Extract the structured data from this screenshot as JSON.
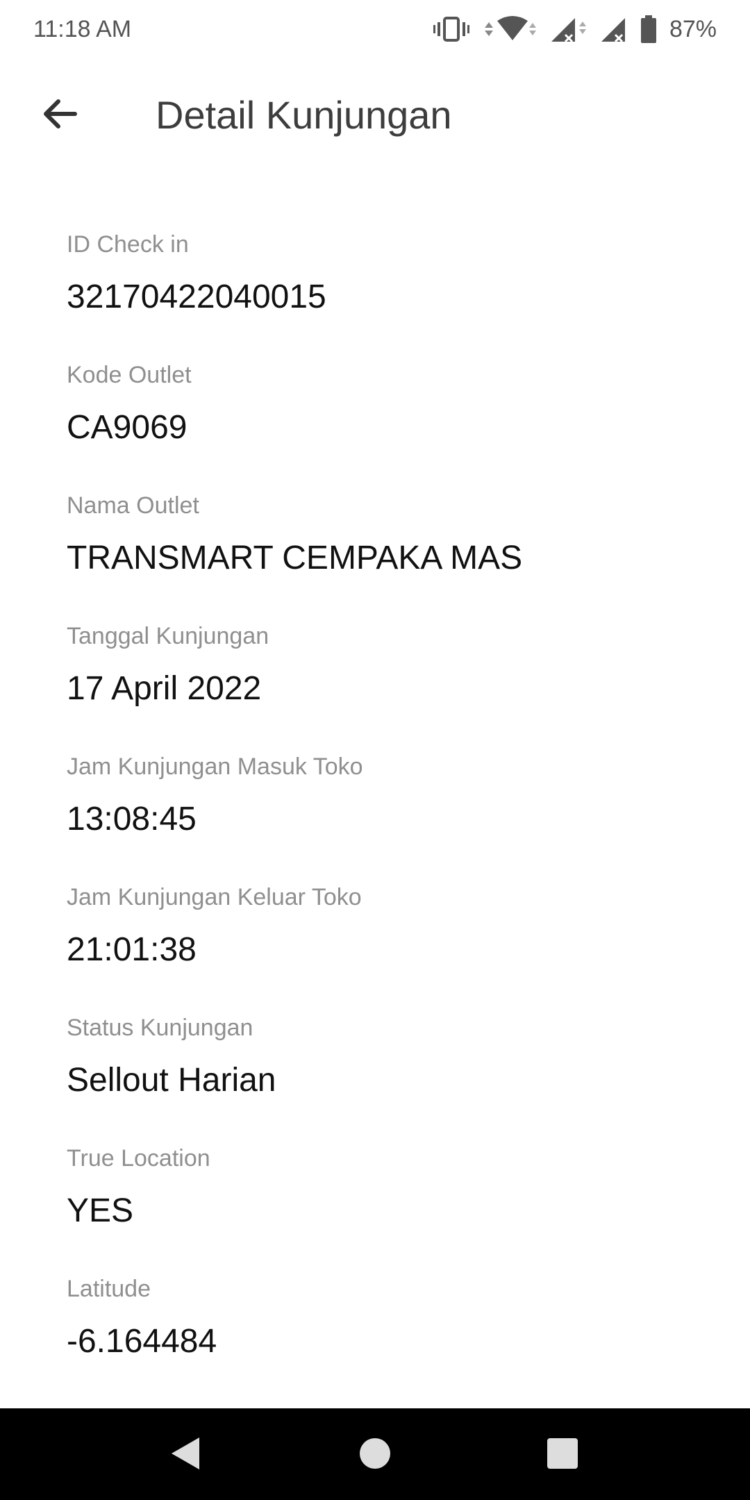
{
  "status_bar": {
    "time": "11:18 AM",
    "battery": "87%",
    "icons": [
      "vibrate-icon",
      "wifi-icon",
      "signal-icon",
      "signal-icon",
      "battery-icon"
    ]
  },
  "app_bar": {
    "title": "Detail Kunjungan",
    "back_icon": "arrow-back-icon"
  },
  "fields": [
    {
      "label": "ID Check in",
      "value": "32170422040015"
    },
    {
      "label": "Kode Outlet",
      "value": "CA9069"
    },
    {
      "label": "Nama Outlet",
      "value": "TRANSMART CEMPAKA MAS"
    },
    {
      "label": "Tanggal Kunjungan",
      "value": "17 April 2022"
    },
    {
      "label": "Jam Kunjungan Masuk Toko",
      "value": "13:08:45"
    },
    {
      "label": "Jam Kunjungan Keluar Toko",
      "value": "21:01:38"
    },
    {
      "label": "Status Kunjungan",
      "value": "Sellout Harian"
    },
    {
      "label": "True Location",
      "value": "YES"
    },
    {
      "label": "Latitude",
      "value": "-6.164484"
    }
  ],
  "nav_bar": {
    "icons": [
      "nav-back-icon",
      "nav-home-icon",
      "nav-recents-icon"
    ]
  }
}
